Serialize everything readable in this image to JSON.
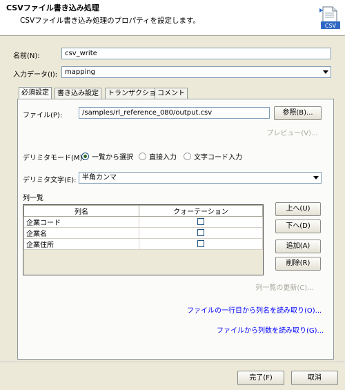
{
  "header": {
    "title": "CSVファイル書き込み処理",
    "description": "CSVファイル書き込み処理のプロパティを設定します。",
    "icon_text": "CSV",
    "icon": "csv-file-icon"
  },
  "form": {
    "name_label": "名前(N):",
    "name_value": "csv_write",
    "input_label": "入力データ(I):",
    "input_value": "mapping"
  },
  "tabs": [
    {
      "label": "必須設定",
      "active": true
    },
    {
      "label": "書き込み設定",
      "active": false
    },
    {
      "label": "トランザクション",
      "active": false
    },
    {
      "label": "コメント",
      "active": false
    }
  ],
  "file": {
    "label": "ファイル(P):",
    "value": "/samples/rl_reference_080/output.csv",
    "browse_label": "参照(B)...",
    "preview_label": "プレビュー(V)..."
  },
  "delimiter_mode": {
    "label": "デリミタモード(M):",
    "options": [
      "一覧から選択",
      "直接入力",
      "文字コード入力"
    ],
    "selected": "一覧から選択"
  },
  "delimiter_char": {
    "label": "デリミタ文字(E):",
    "value": "半角カンマ"
  },
  "columns": {
    "label": "列一覧",
    "headers": [
      "列名",
      "クォーテーション"
    ],
    "rows": [
      {
        "name": "企業コード",
        "quoted": false
      },
      {
        "name": "企業名",
        "quoted": false
      },
      {
        "name": "企業住所",
        "quoted": false
      }
    ],
    "up_label": "上へ(U)",
    "down_label": "下へ(D)",
    "add_label": "追加(A)",
    "delete_label": "削除(R)",
    "refresh_label": "列一覧の更新(C)..."
  },
  "links": {
    "read_first_row": "ファイルの一行目から列名を読み取り(O)...",
    "read_count": "ファイルから列数を読み取り(G)..."
  },
  "footer": {
    "finish_label": "完了(F)",
    "cancel_label": "取消"
  },
  "colors": {
    "dialog_bg": "#ece9d8",
    "link": "#0000ff",
    "disabled_text": "#a8a69c"
  }
}
